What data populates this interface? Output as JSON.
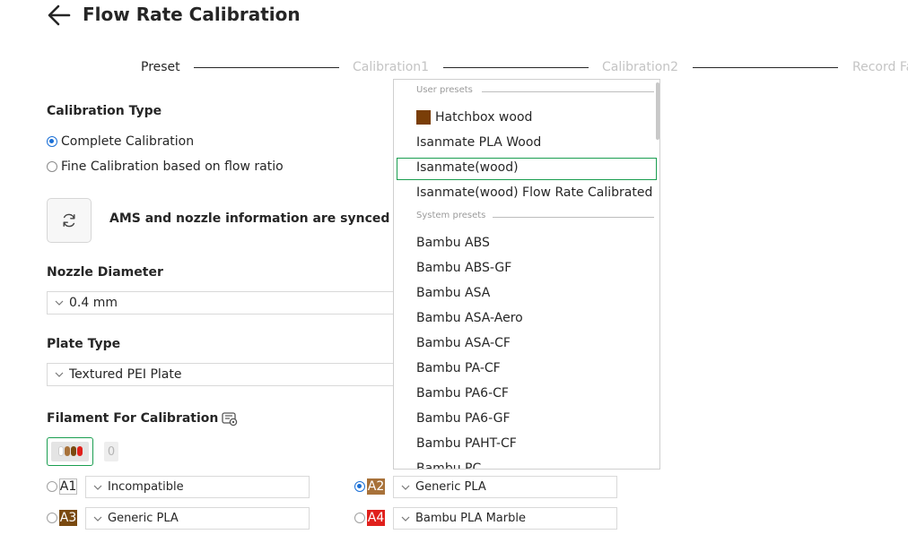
{
  "header": {
    "title": "Flow Rate Calibration"
  },
  "stepper": {
    "steps": [
      "Preset",
      "Calibration1",
      "Calibration2",
      "Record Fa"
    ]
  },
  "calibration_type": {
    "title": "Calibration Type",
    "options": [
      "Complete Calibration",
      "Fine Calibration based on flow ratio"
    ],
    "selected": "Complete Calibration"
  },
  "sync": {
    "text": "AMS and nozzle information are synced"
  },
  "nozzle": {
    "title": "Nozzle Diameter",
    "value": "0.4 mm"
  },
  "plate": {
    "title": "Plate Type",
    "value": "Textured PEI Plate"
  },
  "filament": {
    "title": "Filament For Calibration",
    "external_count": "0",
    "slots": [
      {
        "tag": "A1",
        "tag_color": "#ffffff",
        "text_color": "#262626",
        "value": "Incompatible",
        "selected": false
      },
      {
        "tag": "A2",
        "tag_color": "#a8723a",
        "text_color": "#ffffff",
        "value": "Generic PLA",
        "selected": true
      },
      {
        "tag": "A3",
        "tag_color": "#7a4a10",
        "text_color": "#ffffff",
        "value": "Generic PLA",
        "selected": false
      },
      {
        "tag": "A4",
        "tag_color": "#e0201c",
        "text_color": "#ffffff",
        "value": "Bambu PLA Marble",
        "selected": false
      }
    ]
  },
  "dropdown": {
    "user_group": "User presets",
    "system_group": "System presets",
    "user_items": [
      {
        "label": "Hatchbox wood",
        "swatch": "#7a3e08"
      },
      {
        "label": "Isanmate PLA Wood"
      },
      {
        "label": "Isanmate(wood)",
        "selected": true
      },
      {
        "label": "Isanmate(wood) Flow Rate Calibrated"
      }
    ],
    "system_items": [
      "Bambu ABS",
      "Bambu ABS-GF",
      "Bambu ASA",
      "Bambu ASA-Aero",
      "Bambu ASA-CF",
      "Bambu PA-CF",
      "Bambu PA6-CF",
      "Bambu PA6-GF",
      "Bambu PAHT-CF",
      "Bambu PC"
    ]
  },
  "colors": {
    "accent_green": "#1a9e50",
    "accent_blue": "#1a6fd6"
  }
}
